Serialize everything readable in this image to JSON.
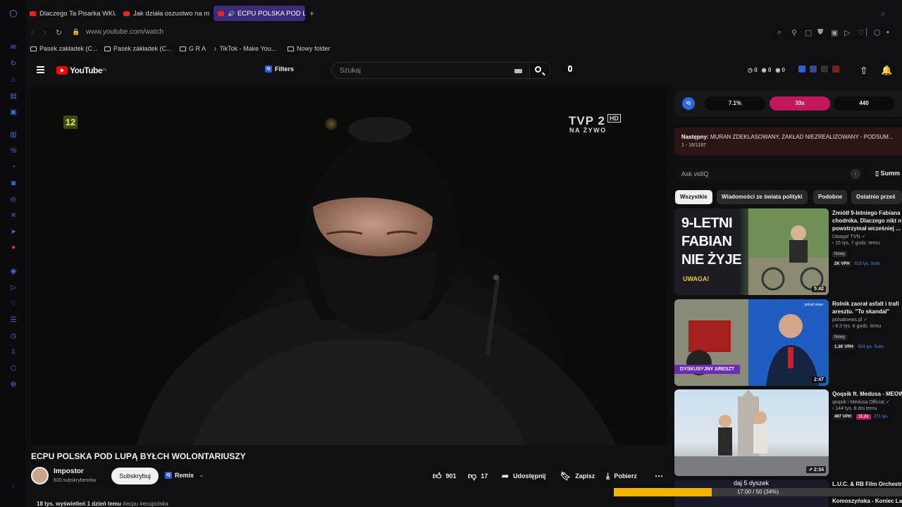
{
  "browser": {
    "tabs": [
      {
        "label": "Dlaczego Ta Pisarka WKUR"
      },
      {
        "label": "Jak działa oszustwo na m"
      },
      {
        "label": "ECPU POLSKA POD LU"
      }
    ],
    "url": "www.youtube.com/watch",
    "bookmarks": [
      "Pasek zakładek (C...",
      "Pasek zakładek (C...",
      "G R A",
      "TikTok - Make You...",
      "Nowy folder"
    ]
  },
  "header": {
    "logo": "YouTube",
    "region": "PL",
    "filters_label": "Filters",
    "search_placeholder": "Szukaj",
    "stats": [
      "0",
      "0",
      "0"
    ]
  },
  "video": {
    "channel_badge": "12",
    "tvp_logo": "TVP 2",
    "tvp_hd": "HD",
    "tvp_live": "NA ŻYWO",
    "title": "ECPU POLSKA POD LUPĄ BYŁCH WOLONTARIUSZY",
    "channel": "Impostor",
    "subscribers": "920 subskrybentów",
    "subscribe_label": "Subskrybuj",
    "remix_label": "Remix",
    "likes": "901",
    "dislikes": "17",
    "share_label": "Udostępnij",
    "save_label": "Zapisz",
    "download_label": "Pobierz",
    "description_meta": "18 tys. wyświetleń  1 dzień temu",
    "description_tags": "#ecpu #ecupolska"
  },
  "vidiq": {
    "logo": "IQ",
    "pills": [
      "7.1%",
      "33x",
      "440"
    ],
    "next_label": "Następny:",
    "next_title": "MURAN ZDEKLASOWANY, ZAKŁAD NIEZREALIZOWANY - PODSUM...",
    "next_position": "1 - 16/1197",
    "ask_placeholder": "Ask vidIQ",
    "summary_label": "Summ"
  },
  "chips": [
    "Wszystkie",
    "Wiadomości ze świata polityki",
    "Podobne",
    "Ostatnio prześ"
  ],
  "related": [
    {
      "thumb_text": [
        "9-LETNI",
        "FABIAN",
        "NIE ŻYJE"
      ],
      "thumb_sub": "UWAGA!",
      "duration": "5:42",
      "title": [
        "Zmiótł 9-letniego Fabiana",
        "chodnika. Dlaczego nikt n",
        "powstrzymał wcześniej ..."
      ],
      "channel": "Uwaga! TVN",
      "meta": "15 tys.  7 godz. temu",
      "new": "Nowy",
      "vph": "2K VPH",
      "extra": "515 tys. Subs"
    },
    {
      "thumb_text": [
        "DYSKUSYJNY ARESZT"
      ],
      "thumb_sub": "polsat news",
      "duration": "2:47",
      "title": [
        "Rolnik zaorał asfalt i trafi",
        "aresztu. \"To skandal\""
      ],
      "channel": "polsatnews.pl",
      "meta": "8,3 tys.  6 godz. temu",
      "new": "Nowy",
      "vph": "1.3K VPH",
      "extra": "524 tys. Subs"
    },
    {
      "thumb_text": [],
      "thumb_sub": "",
      "duration": "2:34",
      "title": [
        "Qoqsik ft. Medusa - MEOW"
      ],
      "channel": "qoqsik i Medusa Official",
      "meta": "144 tys.  8 dni temu",
      "new": "",
      "vph": "497 VPH",
      "multiplier": "11.2x",
      "extra": "271 tys."
    },
    {
      "title": [
        "L.U.C. & RB Film Orchestra",
        "Komoszyńska - Koniec Lata"
      ]
    }
  ],
  "overlay": {
    "label": "daj 5 dyszek",
    "progress_text": "17.00 / 50 (34%)",
    "progress": 0.34
  },
  "colors": {
    "accent_purple": "#3d2c7a",
    "youtube_red": "#ff0000",
    "vidiq_pink": "#c2185b",
    "progress_yellow": "#f0b300"
  }
}
